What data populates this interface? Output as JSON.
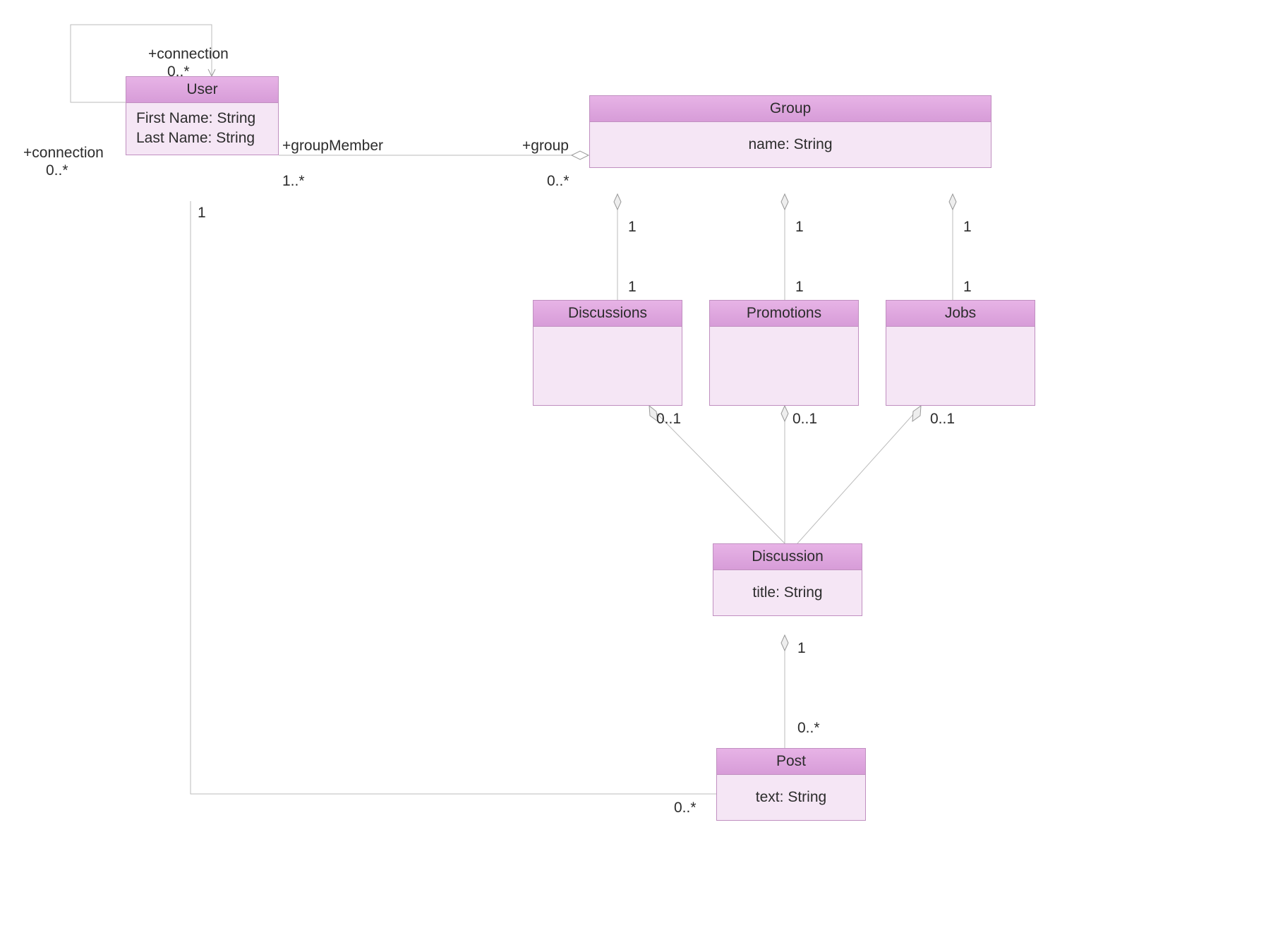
{
  "classes": {
    "user": {
      "name": "User",
      "attrs": [
        "First Name: String",
        "Last Name: String"
      ]
    },
    "group": {
      "name": "Group",
      "attrs": [
        "name: String"
      ]
    },
    "discussions": {
      "name": "Discussions"
    },
    "promotions": {
      "name": "Promotions"
    },
    "jobs": {
      "name": "Jobs"
    },
    "discussion": {
      "name": "Discussion",
      "attrs": [
        "title: String"
      ]
    },
    "post": {
      "name": "Post",
      "attrs": [
        "text: String"
      ]
    }
  },
  "labels": {
    "connectionTop": "+connection",
    "connectionTopMult": "0..*",
    "connectionLeft": "+connection",
    "connectionLeftMult": "0..*",
    "groupMember": "+groupMember",
    "groupMemberMult": "1..*",
    "groupRole": "+group",
    "groupRoleMult": "0..*",
    "one": "1",
    "zeroOne": "0..1",
    "zeroStar": "0..*"
  }
}
